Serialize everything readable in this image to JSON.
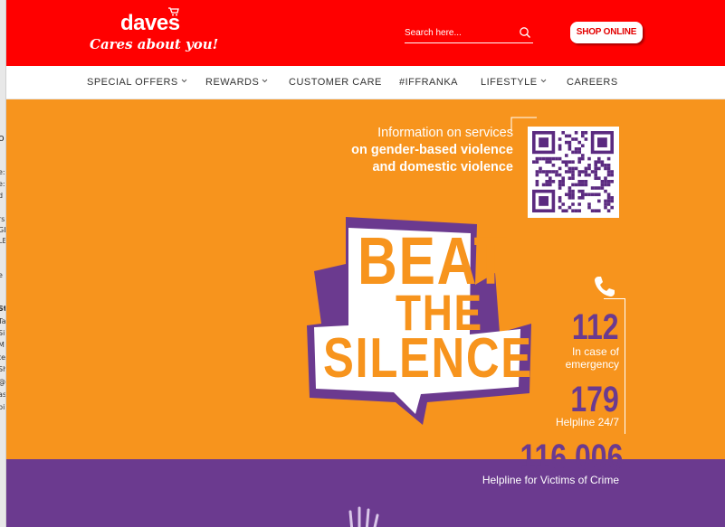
{
  "brand": {
    "logo_word": "daves",
    "tagline": "Cares about you!",
    "color_red": "#ff0000",
    "color_orange": "#f7941d",
    "color_purple": "#6b3a8f"
  },
  "header": {
    "search_placeholder": "Search here...",
    "shop_online": "SHOP ONLINE"
  },
  "nav": {
    "items": [
      {
        "label": "SPECIAL OFFERS",
        "dropdown": true
      },
      {
        "label": "REWARDS",
        "dropdown": true
      },
      {
        "label": "CUSTOMER CARE",
        "dropdown": false
      },
      {
        "label": "#IFFRANKA",
        "dropdown": false
      },
      {
        "label": "LIFESTYLE",
        "dropdown": true
      },
      {
        "label": "CAREERS",
        "dropdown": false
      }
    ]
  },
  "banner": {
    "info_line1": "Information on services",
    "info_line2": "on gender-based violence",
    "info_line3": "and domestic violence",
    "headline_1": "BEAT",
    "headline_2": "THE",
    "headline_3": "SILENCE",
    "hotlines": [
      {
        "number": "112",
        "label_1": "In case of",
        "label_2": "emergency"
      },
      {
        "number": "179",
        "label_1": "Helpline 24/7",
        "label_2": ""
      },
      {
        "number": "116 006",
        "label_1": "Helpline for Victims of Crime",
        "label_2": ""
      }
    ]
  },
  "background_window": {
    "fragments": [
      "o",
      "e:",
      "e:",
      "d",
      "rs",
      "GL",
      "LE",
      "e",
      "St",
      "Ta",
      "Si",
      "M",
      "te",
      "Sh",
      "@b",
      "as",
      "bi"
    ]
  }
}
